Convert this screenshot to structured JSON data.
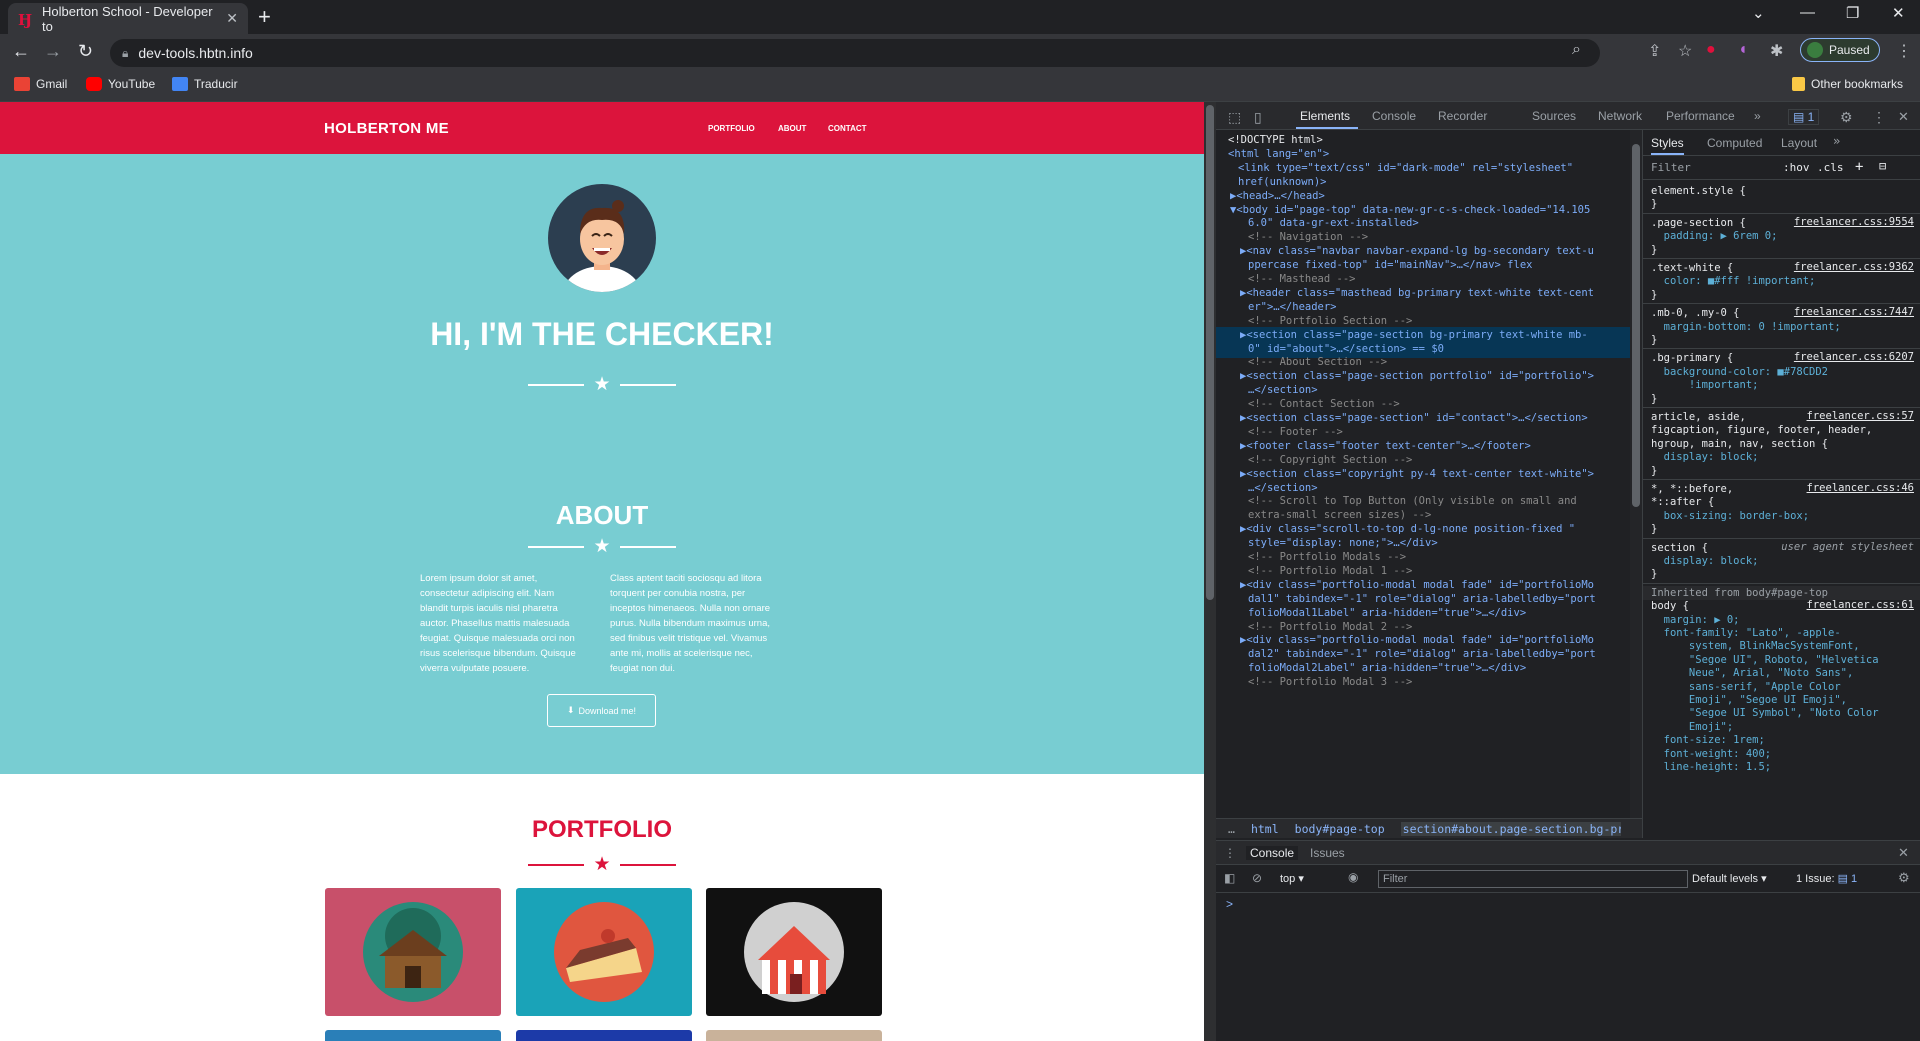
{
  "browser": {
    "tab_title": "Holberton School - Developer to",
    "tab_favicon": "holberton-favicon",
    "url": "dev-tools.hbtn.info",
    "profile_status": "Paused",
    "bookmarks": [
      {
        "label": "Gmail",
        "icon": "gmail-icon",
        "color": "#ea4335"
      },
      {
        "label": "YouTube",
        "icon": "youtube-icon",
        "color": "#ff0000"
      },
      {
        "label": "Traducir",
        "icon": "translate-icon",
        "color": "#4285f4"
      }
    ],
    "other_bookmarks": "Other bookmarks"
  },
  "site": {
    "brand": "HOLBERTON ME",
    "nav": [
      "PORTFOLIO",
      "ABOUT",
      "CONTACT"
    ],
    "hero_title": "HI, I'M THE CHECKER!",
    "about_title": "ABOUT",
    "about_left": "Lorem ipsum dolor sit amet, consectetur adipiscing elit. Nam blandit turpis iaculis nisl pharetra auctor. Phasellus mattis malesuada feugiat. Quisque malesuada orci non risus scelerisque bibendum. Quisque viverra vulputate posuere.",
    "about_right": "Class aptent taciti sociosqu ad litora torquent per conubia nostra, per inceptos himenaeos. Nulla non ornare purus. Nulla bibendum maximus urna, sed finibus velit tristique vel. Vivamus ante mi, mollis at scelerisque nec, feugiat non dui.",
    "download_button": "Download me!",
    "portfolio_title": "PORTFOLIO",
    "colors": {
      "primary": "#dc143c",
      "masthead": "#78CDD2"
    }
  },
  "devtools": {
    "tabs": [
      "Elements",
      "Console",
      "Recorder",
      "Sources",
      "Network",
      "Performance"
    ],
    "issues_badge": "1",
    "dom_lines": [
      {
        "t": "<!DOCTYPE html>",
        "k": "txt"
      },
      {
        "t": "<html lang=\"en\">",
        "k": "tag"
      },
      {
        "t": "<link type=\"text/css\" id=\"dark-mode\" rel=\"stylesheet\"",
        "k": "tag"
      },
      {
        "t": "href(unknown)>",
        "k": "tag"
      },
      {
        "t": "▶<head>…</head>",
        "k": "tag"
      },
      {
        "t": "▼<body id=\"page-top\" data-new-gr-c-s-check-loaded=\"14.105",
        "k": "tag"
      },
      {
        "t": "6.0\" data-gr-ext-installed>",
        "k": "tag"
      },
      {
        "t": "<!-- Navigation -->",
        "k": "cmt"
      },
      {
        "t": "▶<nav class=\"navbar navbar-expand-lg bg-secondary text-u",
        "k": "tag"
      },
      {
        "t": "ppercase fixed-top\" id=\"mainNav\">…</nav> flex",
        "k": "tag"
      },
      {
        "t": "<!-- Masthead -->",
        "k": "cmt"
      },
      {
        "t": "▶<header class=\"masthead bg-primary text-white text-cent",
        "k": "tag"
      },
      {
        "t": "er\">…</header>",
        "k": "tag"
      },
      {
        "t": "<!-- Portfolio Section -->",
        "k": "cmt"
      },
      {
        "t": "▶<section class=\"page-section bg-primary text-white mb-",
        "k": "sel"
      },
      {
        "t": "0\" id=\"about\">…</section> == $0",
        "k": "sel"
      },
      {
        "t": "<!-- About Section -->",
        "k": "cmt"
      },
      {
        "t": "▶<section class=\"page-section portfolio\" id=\"portfolio\">",
        "k": "tag"
      },
      {
        "t": "…</section>",
        "k": "tag"
      },
      {
        "t": "<!-- Contact Section -->",
        "k": "cmt"
      },
      {
        "t": "▶<section class=\"page-section\" id=\"contact\">…</section>",
        "k": "tag"
      },
      {
        "t": "<!-- Footer -->",
        "k": "cmt"
      },
      {
        "t": "▶<footer class=\"footer text-center\">…</footer>",
        "k": "tag"
      },
      {
        "t": "<!-- Copyright Section -->",
        "k": "cmt"
      },
      {
        "t": "▶<section class=\"copyright py-4 text-center text-white\">",
        "k": "tag"
      },
      {
        "t": "…</section>",
        "k": "tag"
      },
      {
        "t": "<!-- Scroll to Top Button (Only visible on small and",
        "k": "cmt"
      },
      {
        "t": "extra-small screen sizes) -->",
        "k": "cmt"
      },
      {
        "t": "▶<div class=\"scroll-to-top d-lg-none position-fixed \"",
        "k": "tag"
      },
      {
        "t": "style=\"display: none;\">…</div>",
        "k": "tag"
      },
      {
        "t": "<!-- Portfolio Modals -->",
        "k": "cmt"
      },
      {
        "t": "<!-- Portfolio Modal 1 -->",
        "k": "cmt"
      },
      {
        "t": "▶<div class=\"portfolio-modal modal fade\" id=\"portfolioMo",
        "k": "tag"
      },
      {
        "t": "dal1\" tabindex=\"-1\" role=\"dialog\" aria-labelledby=\"port",
        "k": "tag"
      },
      {
        "t": "folioModal1Label\" aria-hidden=\"true\">…</div>",
        "k": "tag"
      },
      {
        "t": "<!-- Portfolio Modal 2 -->",
        "k": "cmt"
      },
      {
        "t": "▶<div class=\"portfolio-modal modal fade\" id=\"portfolioMo",
        "k": "tag"
      },
      {
        "t": "dal2\" tabindex=\"-1\" role=\"dialog\" aria-labelledby=\"port",
        "k": "tag"
      },
      {
        "t": "folioModal2Label\" aria-hidden=\"true\">…</div>",
        "k": "tag"
      },
      {
        "t": "<!-- Portfolio Modal 3 -->",
        "k": "cmt"
      }
    ],
    "breadcrumbs": [
      "html",
      "body#page-top",
      "section#about.page-section.bg-primary.te"
    ],
    "styles_tabs": [
      "Styles",
      "Computed",
      "Layout"
    ],
    "styles_filter_placeholder": "Filter",
    "styles_hov": ":hov",
    "styles_cls": ".cls",
    "style_lines": [
      {
        "t": "element.style {",
        "k": "sel-n"
      },
      {
        "t": "}",
        "k": "sel-n"
      },
      {
        "t": ".page-section {",
        "k": "sel-n",
        "src": "freelancer.css:9554"
      },
      {
        "t": "  padding: ▶ 6rem 0;",
        "k": "prop"
      },
      {
        "t": "}",
        "k": "sel-n"
      },
      {
        "t": ".text-white {",
        "k": "sel-n",
        "src": "freelancer.css:9362"
      },
      {
        "t": "  color: ■#fff !important;",
        "k": "prop"
      },
      {
        "t": "}",
        "k": "sel-n"
      },
      {
        "t": ".mb-0, .my-0 {",
        "k": "sel-n",
        "src": "freelancer.css:7447"
      },
      {
        "t": "  margin-bottom: 0 !important;",
        "k": "prop"
      },
      {
        "t": "}",
        "k": "sel-n"
      },
      {
        "t": ".bg-primary {",
        "k": "sel-n",
        "src": "freelancer.css:6207"
      },
      {
        "t": "  background-color: ■#78CDD2",
        "k": "prop"
      },
      {
        "t": "      !important;",
        "k": "prop"
      },
      {
        "t": "}",
        "k": "sel-n"
      },
      {
        "t": "article, aside,",
        "k": "sel-n",
        "src": "freelancer.css:57"
      },
      {
        "t": "figcaption, figure, footer, header,",
        "k": "sel-n"
      },
      {
        "t": "hgroup, main, nav, section {",
        "k": "sel-n"
      },
      {
        "t": "  display: block;",
        "k": "prop"
      },
      {
        "t": "}",
        "k": "sel-n"
      },
      {
        "t": "*, *::before,",
        "k": "sel-n",
        "src": "freelancer.css:46"
      },
      {
        "t": "*::after {",
        "k": "sel-n"
      },
      {
        "t": "  box-sizing: border-box;",
        "k": "prop"
      },
      {
        "t": "}",
        "k": "sel-n"
      },
      {
        "t": "section {",
        "k": "sel-n",
        "src": "user agent stylesheet"
      },
      {
        "t": "  display: block;",
        "k": "prop"
      },
      {
        "t": "}",
        "k": "sel-n"
      },
      {
        "t": "Inherited from body#page-top",
        "k": "sel-n"
      },
      {
        "t": "body {",
        "k": "sel-n",
        "src": "freelancer.css:61"
      },
      {
        "t": "  margin: ▶ 0;",
        "k": "prop"
      },
      {
        "t": "  font-family: \"Lato\", -apple-",
        "k": "prop"
      },
      {
        "t": "      system, BlinkMacSystemFont,",
        "k": "prop"
      },
      {
        "t": "      \"Segoe UI\", Roboto, \"Helvetica",
        "k": "prop"
      },
      {
        "t": "      Neue\", Arial, \"Noto Sans\",",
        "k": "prop"
      },
      {
        "t": "      sans-serif, \"Apple Color",
        "k": "prop"
      },
      {
        "t": "      Emoji\", \"Segoe UI Emoji\",",
        "k": "prop"
      },
      {
        "t": "      \"Segoe UI Symbol\", \"Noto Color",
        "k": "prop"
      },
      {
        "t": "      Emoji\";",
        "k": "prop"
      },
      {
        "t": "  font-size: 1rem;",
        "k": "prop"
      },
      {
        "t": "  font-weight: 400;",
        "k": "prop"
      },
      {
        "t": "  line-height: 1.5;",
        "k": "prop"
      }
    ],
    "drawer_tabs": [
      "Console",
      "Issues"
    ],
    "console_context": "top",
    "console_filter_placeholder": "Filter",
    "console_levels": "Default levels",
    "console_issues": "1 Issue:",
    "console_issue_count": "1",
    "console_prompt": ">"
  }
}
